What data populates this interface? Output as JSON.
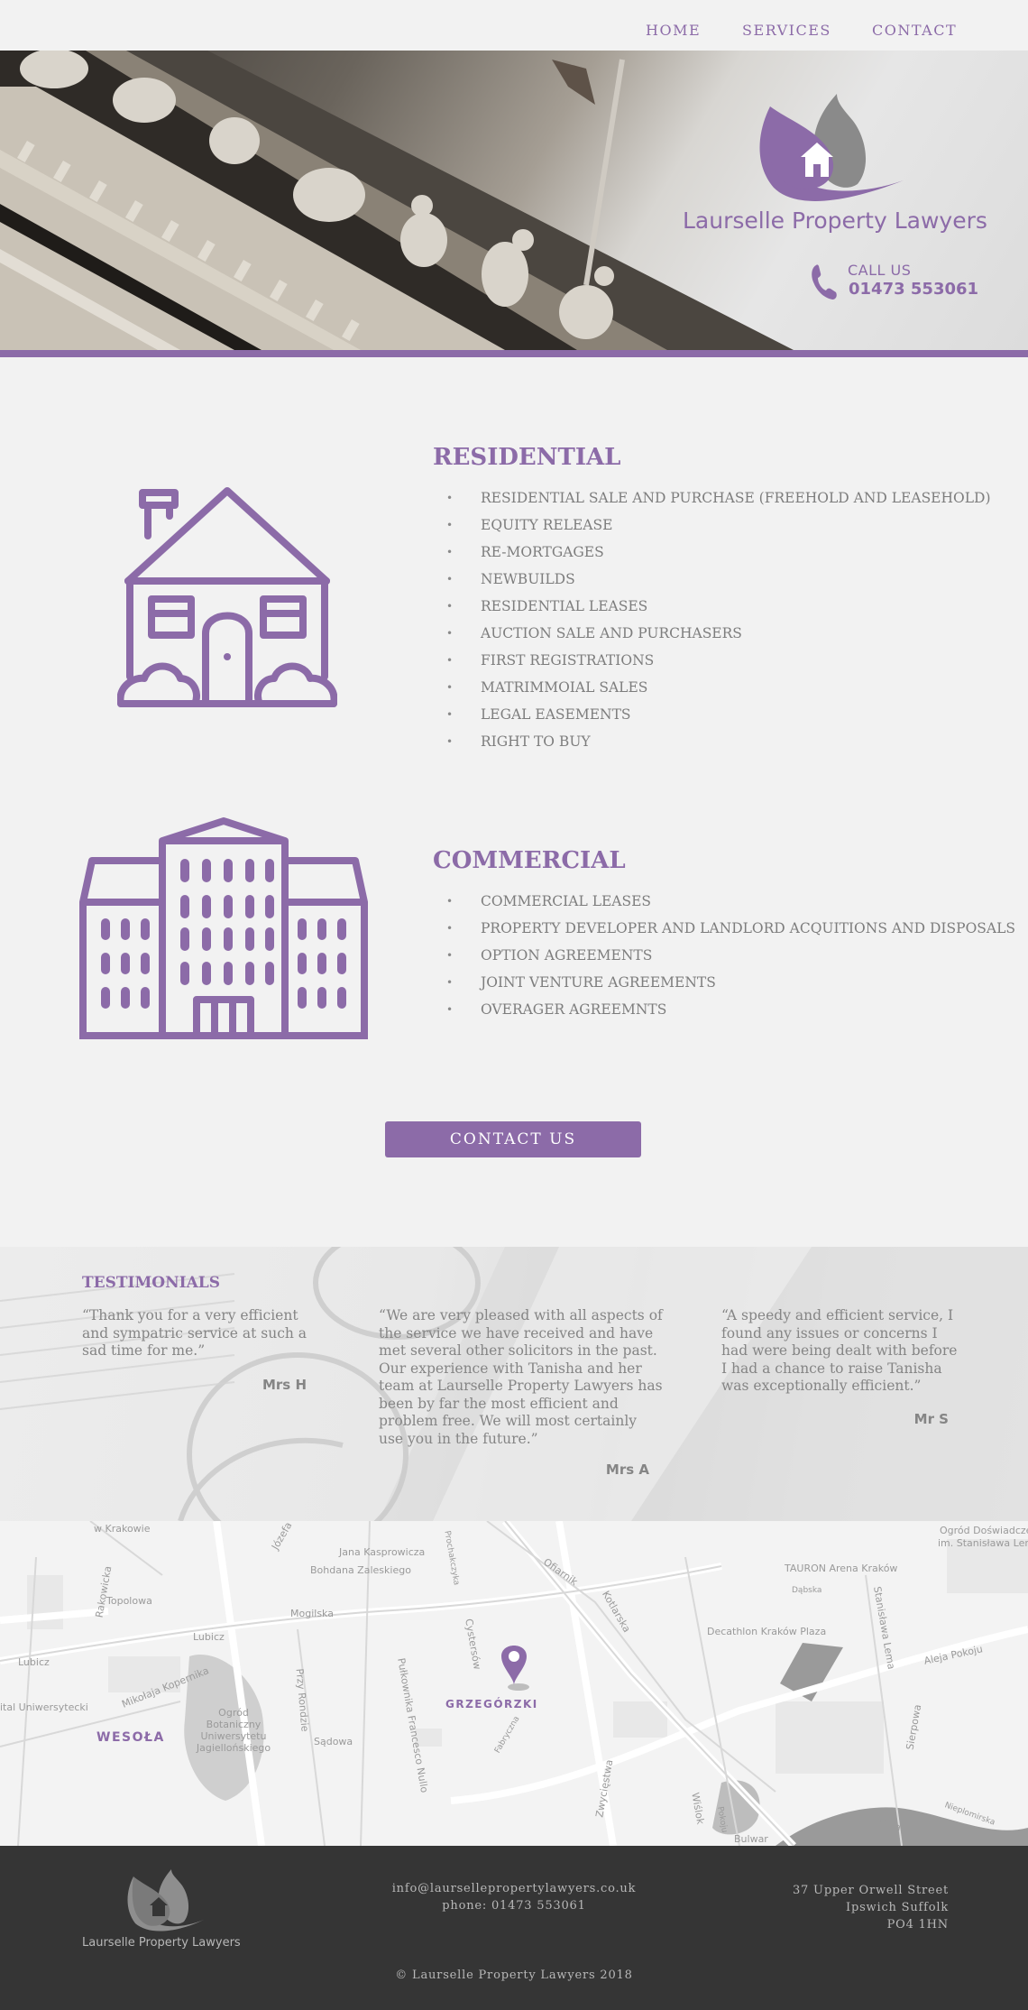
{
  "nav": {
    "items": [
      {
        "label": "HOME"
      },
      {
        "label": "SERVICES"
      },
      {
        "label": "CONTACT"
      }
    ]
  },
  "hero": {
    "brand_name": "Laurselle Property Lawyers",
    "call_label": "CALL US",
    "phone": "01473 553061"
  },
  "residential": {
    "title": "RESIDENTIAL",
    "items": [
      "RESIDENTIAL SALE AND PURCHASE (FREEHOLD AND LEASEHOLD)",
      "EQUITY RELEASE",
      "RE-MORTGAGES",
      "NEWBUILDS",
      "RESIDENTIAL LEASES",
      "AUCTION SALE AND PURCHASERS",
      "FIRST REGISTRATIONS",
      "MATRIMMOIAL SALES",
      "LEGAL EASEMENTS",
      "RIGHT TO BUY"
    ]
  },
  "commercial": {
    "title": "COMMERCIAL",
    "items": [
      "COMMERCIAL LEASES",
      "PROPERTY DEVELOPER AND LANDLORD ACQUITIONS AND DISPOSALS",
      "OPTION AGREEMENTS",
      "JOINT VENTURE AGREEMENTS",
      "OVERAGER AGREEMNTS"
    ]
  },
  "contact_button": "CONTACT US",
  "testimonials": {
    "heading": "TESTIMONIALS",
    "items": [
      {
        "lines": [
          "“Thank you for a very efficient",
          "and sympatric service at such a",
          "sad time for me.”"
        ],
        "author": "Mrs H"
      },
      {
        "lines": [
          "“We are very pleased with all aspects of",
          "the service we have received and have",
          "met several other solicitors in the past.",
          "Our experience with Tanisha and her",
          "team at Laurselle Property Lawyers has",
          "been by far the most efficient and",
          "problem free. We will most certainly",
          "use you in the future.”"
        ],
        "author": "Mrs A"
      },
      {
        "lines": [
          "“A speedy and efficient service, I",
          "found any issues or concerns I",
          "had were being dealt with before",
          "I had a chance to raise Tanisha",
          "was exceptionally efficient.”"
        ],
        "author": "Mr S"
      }
    ]
  },
  "map": {
    "pin_label": "GRZEGÓRZKI",
    "district": "WESOŁA",
    "labels": [
      "w Krakowie",
      "Józefa",
      "Jana Kasprowicza",
      "Bohdana Zaleskiego",
      "Topolowa",
      "Rakowicka",
      "Mogilska",
      "Lubicz",
      "Ogród Doświadczeń",
      "im. Stanisława Lema",
      "TAURON Arena Kraków",
      "Dąbska",
      "Decathlon Kraków Plaza",
      "Aleja Pokoju",
      "Ogród Botaniczny Uniwersytetu Jagiellońskiego",
      "Mikołaja Kopernika",
      "ital Uniwersytecki",
      "Sądowa",
      "Przy Rondzie",
      "Pułkownika Francesco Nullo",
      "Fabryczna",
      "Zwycięstwa",
      "Wisła",
      "Bulwar",
      "Wiślok",
      "Sierpowa",
      "Stanisława Lema",
      "Daniela Chodowieckiego",
      "Lubicz",
      "Cystersów",
      "Prochakczyka",
      "Ofiarnik",
      "Kotlarska",
      "Nieplomirska",
      "Pokoju",
      "Bokota"
    ]
  },
  "footer": {
    "brand": "Laurselle Property Lawyers",
    "email": "info@laursellepropertylawyers.co.uk",
    "phone": "phone: 01473 553061",
    "address": [
      "37 Upper Orwell Street",
      "Ipswich Suffolk",
      "PO4 1HN"
    ],
    "copyright": "© Laurselle Property Lawyers 2018"
  },
  "colors": {
    "accent": "#8c6ba8",
    "background": "#f2f2f2",
    "footer": "#353535",
    "text": "#858585"
  }
}
